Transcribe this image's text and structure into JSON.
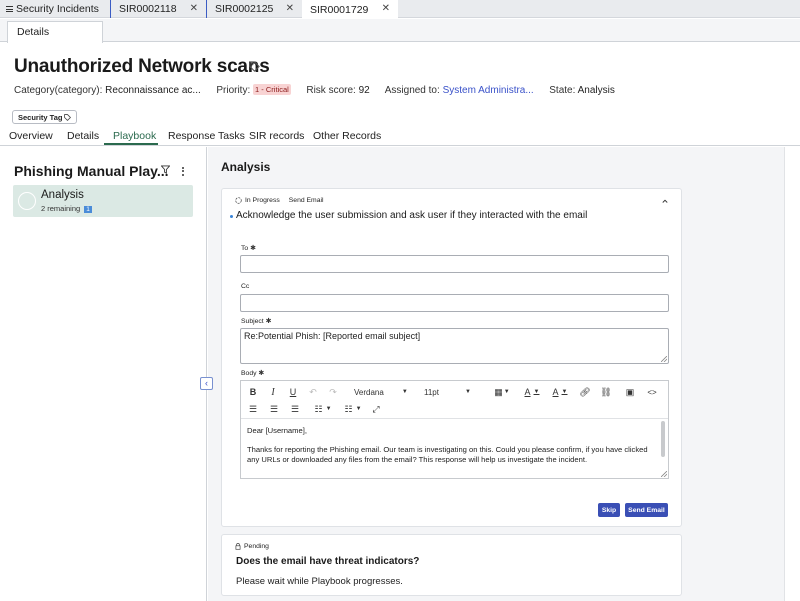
{
  "tabs": [
    {
      "label": "Security Incidents",
      "closable": false
    },
    {
      "label": "SIR0002118",
      "closable": true
    },
    {
      "label": "SIR0002125",
      "closable": true
    },
    {
      "label": "SIR0001729",
      "closable": true,
      "active": true
    }
  ],
  "details_tab": "Details",
  "record": {
    "title": "Unauthorized Network scans",
    "category_label": "Category(category):",
    "category_value": "Reconnaissance ac...",
    "priority_label": "Priority:",
    "priority_value": "1 - Critical",
    "risk_label": "Risk score:",
    "risk_value": "92",
    "assigned_label": "Assigned to:",
    "assigned_value": "System Administra...",
    "state_label": "State:",
    "state_value": "Analysis",
    "security_tag": "Security Tag"
  },
  "record_tabs": [
    "Overview",
    "Details",
    "Playbook",
    "Response Tasks",
    "SIR records",
    "Other Records"
  ],
  "active_record_tab": "Playbook",
  "playbook": {
    "title": "Phishing Manual Play...",
    "phase_name": "Analysis",
    "phase_remaining": "2 remaining",
    "phase_count": "1"
  },
  "analysis": {
    "heading": "Analysis",
    "activity": {
      "status": "In Progress",
      "type": "Send Email",
      "title": "Acknowledge the user submission and ask user if they interacted with the email",
      "to_label": "To",
      "to_value": "",
      "cc_label": "Cc",
      "cc_value": "",
      "subject_label": "Subject",
      "subject_value": "Re:Potential Phish: [Reported email subject]",
      "body_label": "Body",
      "font_family": "Verdana",
      "font_size": "11pt",
      "body_greeting": "Dear [Username],",
      "body_text": "Thanks for reporting the Phishing email. Our team is investigating on this. Could you please confirm, if you have clicked any URLs or downloaded any files from the email? This response will help us investigate the incident.",
      "skip_label": "Skip",
      "send_label": "Send Email"
    },
    "pending": {
      "status": "Pending",
      "question": "Does the email have threat indicators?",
      "message": "Please wait while Playbook progresses."
    }
  },
  "colors": {
    "accent": "#3a4fb5",
    "active_tab": "#2b6a4e",
    "phase_bg": "#dbe9e4",
    "critical_bg": "#f8d3d3",
    "link": "#3a52c9"
  }
}
